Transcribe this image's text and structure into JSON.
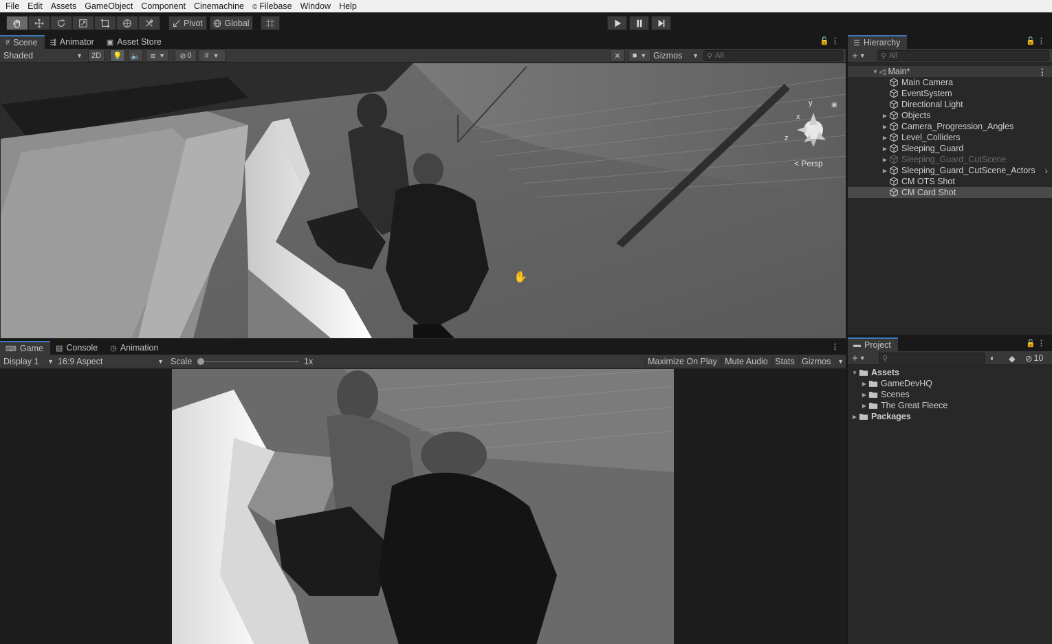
{
  "menu": [
    "File",
    "Edit",
    "Assets",
    "GameObject",
    "Component",
    "Cinemachine",
    "Filebase",
    "Window",
    "Help"
  ],
  "toolbar": {
    "pivot_label": "Pivot",
    "global_label": "Global"
  },
  "scene_panel": {
    "tabs": [
      "Scene",
      "Animator",
      "Asset Store"
    ],
    "shading_mode": "Shaded",
    "mode_2d": "2D",
    "hidden_count": "0",
    "gizmos_label": "Gizmos",
    "search_placeholder": "All",
    "gizmo_axes": {
      "y": "y",
      "x": "x",
      "z": "z"
    },
    "projection_label": "< Persp"
  },
  "game_panel": {
    "tabs": [
      "Game",
      "Console",
      "Animation"
    ],
    "display": "Display 1",
    "aspect": "16:9 Aspect",
    "scale_label": "Scale",
    "scale_value": "1x",
    "scale_fraction": 0.0,
    "maximize_label": "Maximize On Play",
    "mute_label": "Mute Audio",
    "stats_label": "Stats",
    "gizmos_label": "Gizmos"
  },
  "hierarchy": {
    "title": "Hierarchy",
    "search_placeholder": "All",
    "scene_name": "Main*",
    "items": [
      {
        "label": "Main Camera",
        "foldable": false,
        "dim": false,
        "selected": false
      },
      {
        "label": "EventSystem",
        "foldable": false,
        "dim": false,
        "selected": false
      },
      {
        "label": "Directional Light",
        "foldable": false,
        "dim": false,
        "selected": false
      },
      {
        "label": "Objects",
        "foldable": true,
        "dim": false,
        "selected": false
      },
      {
        "label": "Camera_Progression_Angles",
        "foldable": true,
        "dim": false,
        "selected": false
      },
      {
        "label": "Level_Colliders",
        "foldable": true,
        "dim": false,
        "selected": false
      },
      {
        "label": "Sleeping_Guard",
        "foldable": true,
        "dim": false,
        "selected": false
      },
      {
        "label": "Sleeping_Guard_CutScene",
        "foldable": true,
        "dim": true,
        "selected": false
      },
      {
        "label": "Sleeping_Guard_CutScene_Actors",
        "foldable": true,
        "dim": false,
        "selected": false
      },
      {
        "label": "CM OTS Shot",
        "foldable": false,
        "dim": false,
        "selected": false
      },
      {
        "label": "CM Card Shot",
        "foldable": false,
        "dim": false,
        "selected": true
      }
    ]
  },
  "project": {
    "title": "Project",
    "hidden_count": "10",
    "tree": [
      {
        "label": "Assets",
        "level": 0,
        "bold": true,
        "expanded": true
      },
      {
        "label": "GameDevHQ",
        "level": 1,
        "bold": false,
        "expanded": false
      },
      {
        "label": "Scenes",
        "level": 1,
        "bold": false,
        "expanded": false
      },
      {
        "label": "The Great Fleece",
        "level": 1,
        "bold": false,
        "expanded": false
      },
      {
        "label": "Packages",
        "level": 0,
        "bold": true,
        "expanded": false
      }
    ]
  }
}
